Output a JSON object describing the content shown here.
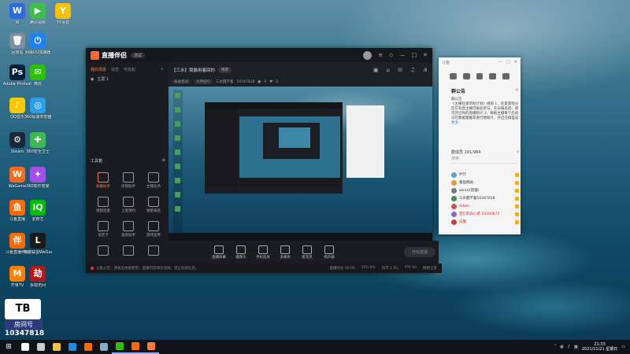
{
  "desktop": {
    "icons": [
      {
        "label": "W",
        "color": "#2b6ae0",
        "glyph": "W",
        "name": "wps-icon"
      },
      {
        "label": "腾讯视频",
        "color": "#3fbf4a",
        "glyph": "▶",
        "name": "tencent-video-icon"
      },
      {
        "label": "YY语音",
        "color": "#f5c400",
        "glyph": "Y",
        "name": "yy-voice-icon"
      },
      {
        "label": "回收站",
        "color": "#7d8fa0",
        "glyph": "🗑",
        "name": "recycle-bin-icon"
      },
      {
        "label": "网易UU加速器",
        "color": "#1e80ff",
        "glyph": "⏻",
        "name": "uu-accelerator-icon"
      },
      {
        "label": "Adobe Photosh...",
        "color": "#001e36",
        "glyph": "Ps",
        "name": "photoshop-icon"
      },
      {
        "label": "微信",
        "color": "#2dc100",
        "glyph": "✉",
        "name": "wechat-icon"
      },
      {
        "label": "QQ音乐",
        "color": "#f8c800",
        "glyph": "♪",
        "name": "qq-music-icon"
      },
      {
        "label": "360极速浏览器",
        "color": "#2b9fe8",
        "glyph": "◎",
        "name": "360-browser-icon"
      },
      {
        "label": "Steam",
        "color": "#1b2838",
        "glyph": "⚙",
        "name": "steam-icon"
      },
      {
        "label": "360安全卫士",
        "color": "#3cba54",
        "glyph": "✚",
        "name": "360-security-icon"
      },
      {
        "label": "WeGame",
        "color": "#ff6b1a",
        "glyph": "W",
        "name": "wegame-icon"
      },
      {
        "label": "360软件管家",
        "color": "#a350e8",
        "glyph": "✦",
        "name": "360-software-icon"
      },
      {
        "label": "斗鱼直播",
        "color": "#ff6a00",
        "glyph": "鱼",
        "name": "douyu-icon"
      },
      {
        "label": "爱奇艺",
        "color": "#00be06",
        "glyph": "iQ",
        "name": "iqiyi-icon"
      },
      {
        "label": "斗鱼直播伴侣",
        "color": "#ff6a00",
        "glyph": "伴",
        "name": "douyu-companion-icon"
      },
      {
        "label": "英雄联盟WeGame版",
        "color": "#1a1a1a",
        "glyph": "L",
        "name": "lol-wegame-icon"
      },
      {
        "label": "芒果TV",
        "color": "#ff7f00",
        "glyph": "M",
        "name": "mango-tv-icon"
      },
      {
        "label": "永劫无间",
        "color": "#b21a1a",
        "glyph": "劫",
        "name": "naraka-icon"
      }
    ],
    "room_badge": {
      "line1": "房间号",
      "number": "10347818",
      "avatar_text": "TB"
    }
  },
  "app": {
    "title": "直播伴侣",
    "version": "测试",
    "tabs": [
      "我的场景",
      "双击",
      "可收起"
    ],
    "scene_label": "主屏 1",
    "toolbox_title": "工具箱",
    "tools": [
      "屏幕助手",
      "房管助手",
      "主播任务",
      "视频连麦",
      "上麦预约",
      "福星排名",
      "语音卡",
      "道具助手",
      "游戏宣传",
      "",
      "",
      ""
    ],
    "room_title": "【三水】我像用着回的",
    "edit_label": "修改",
    "room_category": "永劫无间",
    "room_tag": "大神指引",
    "room_owner": "三水醒不着",
    "room_id": "10347818",
    "room_viewers": "9",
    "room_likes": "0",
    "controls": [
      "直播屏幕",
      "摄像头",
      "手机投屏",
      "多媒体",
      "麦克风",
      "扬声器"
    ],
    "go_live": "开始直播",
    "status_text": "斗鱼公告：请收支依规使用，直播内容请勿违规，禁止低俗信息。",
    "stats": [
      "直播时长 00:00",
      "CPU 6%",
      "内存 1.5G",
      "FPS 60",
      "网络正常"
    ]
  },
  "chat": {
    "window_title": "斗鱼",
    "section_title": "群公告",
    "notice_heading": "群公告",
    "notice_body": "《主播任意带粉计划》规则 1、任意游戏分区在有直主播可报名参与，在去报名后，即可开启你的直播粉计 2、根据主播每个启动与在数据量推荐进行增粉计，开启在群里返",
    "more_label": "更多",
    "members_label": "群成员 291/984",
    "search_placeholder": "搜索",
    "members": [
      {
        "name": "叶行",
        "color": "#5aa0e8",
        "red": false
      },
      {
        "name": "猿鱼网站",
        "color": "#e89b2a",
        "red": false
      },
      {
        "name": "wenzi(管理)",
        "color": "#7a7a7a",
        "red": false
      },
      {
        "name": "三水醒不着10347818",
        "color": "#3a8f5a",
        "red": false
      },
      {
        "name": "Adam",
        "color": "#d25050",
        "red": true
      },
      {
        "name": "若忆的白心草 10300872",
        "color": "#8a6ad0",
        "red": true
      },
      {
        "name": "白摩",
        "color": "#c04040",
        "red": true
      }
    ]
  },
  "taskbar": {
    "time": "21:33",
    "date": "2021/11/21 星期日",
    "lang": "英",
    "apps": [
      {
        "name": "search",
        "color": "#ffffff"
      },
      {
        "name": "task-view",
        "color": "#cccccc"
      },
      {
        "name": "explorer",
        "color": "#f3c23d"
      },
      {
        "name": "edge",
        "color": "#1d8fe1"
      },
      {
        "name": "browser-g",
        "color": "#ff6a00"
      },
      {
        "name": "steam",
        "color": "#88a9c5"
      },
      {
        "name": "wechat",
        "color": "#2dc100"
      },
      {
        "name": "douyu",
        "color": "#ff6a00"
      },
      {
        "name": "douyu-companion",
        "color": "#ff7a3c"
      }
    ]
  }
}
